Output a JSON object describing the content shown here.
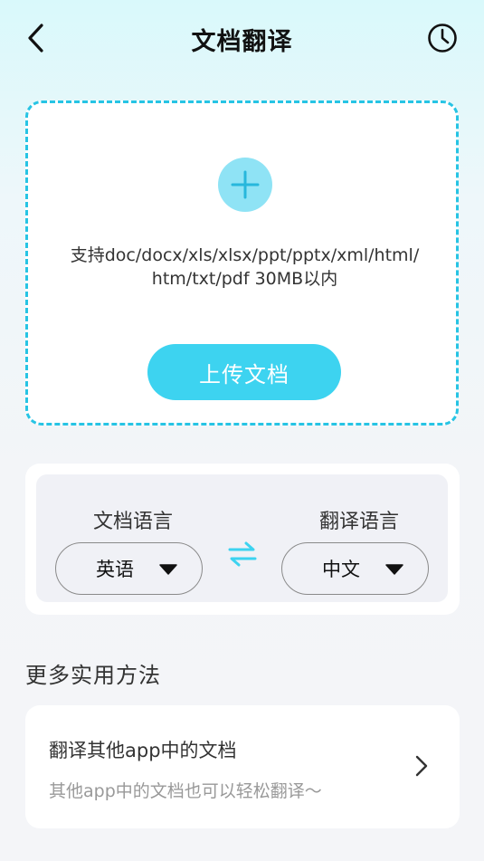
{
  "header": {
    "title": "文档翻译",
    "back_icon": "chevron-left-icon",
    "history_icon": "clock-icon"
  },
  "upload": {
    "add_icon": "plus-icon",
    "support_line1": "支持doc/docx/xls/xlsx/ppt/pptx/xml/html/",
    "support_line2": "htm/txt/pdf 30MB以内",
    "button_label": "上传文档"
  },
  "language": {
    "source_label": "文档语言",
    "target_label": "翻译语言",
    "source_value": "英语",
    "target_value": "中文",
    "swap_icon": "swap-arrows-icon",
    "dropdown_icon": "caret-down-icon"
  },
  "more": {
    "section_title": "更多实用方法",
    "item_title": "翻译其他app中的文档",
    "item_subtitle": "其他app中的文档也可以轻松翻译～",
    "arrow_icon": "chevron-right-icon"
  },
  "colors": {
    "accent": "#3dd3f0",
    "dashed_border": "#27c4e4",
    "plus_bg": "#8fe3f5"
  }
}
